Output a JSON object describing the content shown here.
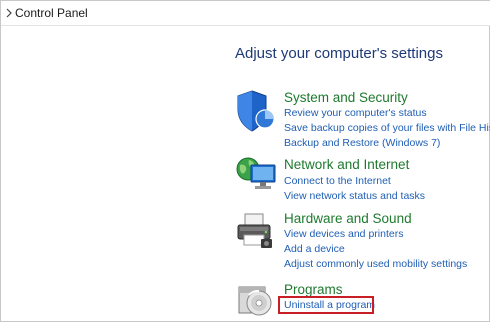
{
  "breadcrumb": {
    "label": "Control Panel"
  },
  "page": {
    "heading": "Adjust your computer's settings"
  },
  "categories": [
    {
      "title": "System and Security",
      "icon": "shield-icon",
      "links": [
        "Review your computer's status",
        "Save backup copies of your files with File History",
        "Backup and Restore (Windows 7)"
      ]
    },
    {
      "title": "Network and Internet",
      "icon": "network-globe-icon",
      "links": [
        "Connect to the Internet",
        "View network status and tasks"
      ]
    },
    {
      "title": "Hardware and Sound",
      "icon": "printer-icon",
      "links": [
        "View devices and printers",
        "Add a device",
        "Adjust commonly used mobility settings"
      ]
    },
    {
      "title": "Programs",
      "icon": "programs-disc-icon",
      "links": [
        "Uninstall a program"
      ]
    }
  ],
  "colors": {
    "category_title": "#1e7a2e",
    "link": "#1f5fb5",
    "heading": "#1e3a78",
    "highlight_box": "#c81e25"
  }
}
